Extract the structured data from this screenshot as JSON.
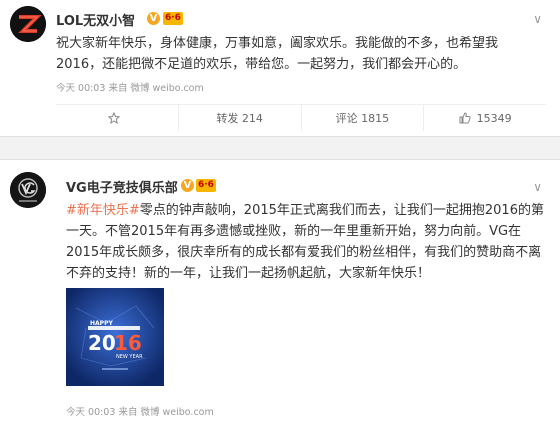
{
  "posts": [
    {
      "author": "LOL无双小智",
      "badge": "6·6",
      "text": "祝大家新年快乐，身体健康，万事如意，阖家欢乐。我能做的不多，也希望我2016，还能把微不足道的欢乐，带给您。一起努力，我们都会开心的。",
      "time": "今天 00:03",
      "source_prefix": "来自",
      "source": "微博 weibo.com",
      "actions": {
        "bookmark_icon": "bookmark-icon",
        "repost_label": "转发 214",
        "comment_label": "评论 1815",
        "like_count": "15349"
      }
    },
    {
      "author": "VG电子竞技俱乐部",
      "badge": "6·6",
      "hashtag": "#新年快乐#",
      "text": "零点的钟声敲响，2015年正式离我们而去，让我们一起拥抱2016的第一天。不管2015年有再多遗憾或挫败，新的一年里重新开始，努力向前。VG在2015年成长颇多，很庆幸所有的成长都有爱我们的粉丝相伴，有我们的赞助商不离不弃的支持！新的一年，让我们一起扬帆起航，大家新年快乐！",
      "image": {
        "line1": "HAPPY",
        "year_a": "20",
        "year_b": "16",
        "line2": "NEW YEAR"
      },
      "time": "今天 00:03",
      "source_prefix": "来自",
      "source": "微博 weibo.com"
    }
  ],
  "colors": {
    "hashtag": "#eb7350",
    "gap": "#f2f2f2",
    "verified": "#f5a623"
  }
}
